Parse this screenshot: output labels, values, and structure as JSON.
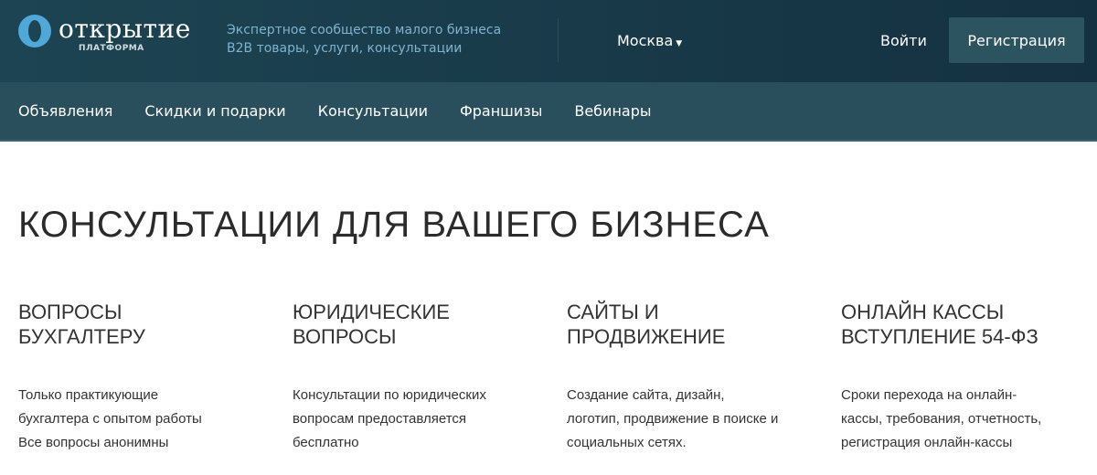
{
  "header": {
    "logo_name": "открытие",
    "logo_sub": "ПЛАТФОРМА",
    "tagline1": "Экспертное сообщество малого бизнеса",
    "tagline2": "B2B товары, услуги, консультации",
    "city": "Москва",
    "login": "Войти",
    "register": "Регистрация"
  },
  "nav": [
    "Объявления",
    "Скидки и подарки",
    "Консультации",
    "Франшизы",
    "Вебинары"
  ],
  "main": {
    "title": "КОНСУЛЬТАЦИИ ДЛЯ ВАШЕГО БИЗНЕСА",
    "cards": [
      {
        "title1": "ВОПРОСЫ",
        "title2": "БУХГАЛТЕРУ",
        "lines": [
          "Только практикующие",
          "бухгалтера с опытом работы",
          "Все вопросы анонимны"
        ]
      },
      {
        "title1": "ЮРИДИЧЕСКИЕ",
        "title2": "ВОПРОСЫ",
        "lines": [
          "Консультации по юридических",
          "вопросам предоставляется",
          "бесплатно"
        ]
      },
      {
        "title1": "САЙТЫ И",
        "title2": "ПРОДВИЖЕНИЕ",
        "lines": [
          "Создание сайта, дизайн,",
          "логотип, продвижение в поиске и",
          "социальных сетях."
        ]
      },
      {
        "title1": "ОНЛАЙН КАССЫ",
        "title2": "ВСТУПЛЕНИЕ 54-ФЗ",
        "lines": [
          "Сроки перехода на онлайн-",
          "кассы, требования, отчетность,",
          "регистрация онлайн-кассы"
        ]
      }
    ]
  }
}
